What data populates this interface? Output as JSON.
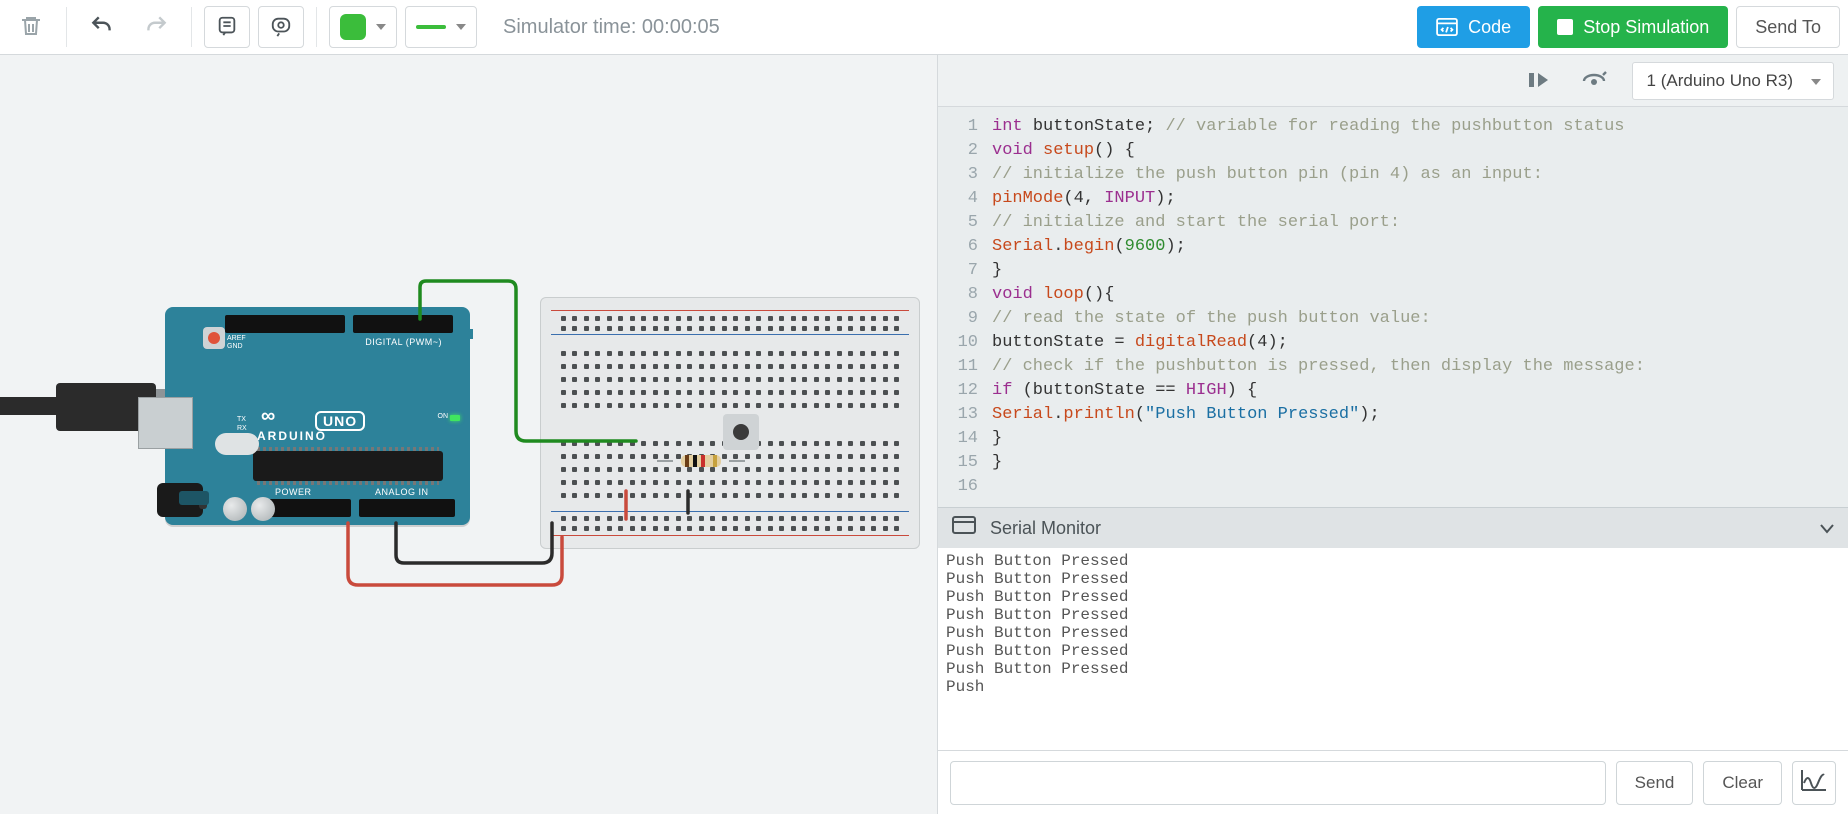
{
  "toolbar": {
    "sim_time_label": "Simulator time: 00:00:05",
    "code_label": "Code",
    "stop_label": "Stop Simulation",
    "sendto_label": "Send To",
    "color_swatch": "#3bbd3b",
    "wire_color": "#3bbd3b"
  },
  "code_header": {
    "board_select": "1 (Arduino Uno R3)"
  },
  "editor": {
    "line_numbers": [
      "1",
      "2",
      "3",
      "4",
      "5",
      "6",
      "7",
      "8",
      "9",
      "10",
      "11",
      "12",
      "13",
      "14",
      "15",
      "16"
    ],
    "lines": [
      [
        {
          "t": "int ",
          "c": "kw"
        },
        {
          "t": "buttonState; ",
          "c": ""
        },
        {
          "t": "// variable for reading the pushbutton status",
          "c": "cm"
        }
      ],
      [
        {
          "t": "void ",
          "c": "kw"
        },
        {
          "t": "setup",
          "c": "fn"
        },
        {
          "t": "() {",
          "c": ""
        }
      ],
      [
        {
          "t": "// initialize the push button pin (pin 4) as an input:",
          "c": "cm"
        }
      ],
      [
        {
          "t": "pinMode",
          "c": "fn"
        },
        {
          "t": "(4, ",
          "c": ""
        },
        {
          "t": "INPUT",
          "c": "kw"
        },
        {
          "t": ");",
          "c": ""
        }
      ],
      [
        {
          "t": "// initialize and start the serial port:",
          "c": "cm"
        }
      ],
      [
        {
          "t": "Serial",
          "c": "fn"
        },
        {
          "t": ".",
          "c": ""
        },
        {
          "t": "begin",
          "c": "fn"
        },
        {
          "t": "(",
          "c": ""
        },
        {
          "t": "9600",
          "c": "num"
        },
        {
          "t": ");",
          "c": ""
        }
      ],
      [
        {
          "t": "}",
          "c": ""
        }
      ],
      [
        {
          "t": "void ",
          "c": "kw"
        },
        {
          "t": "loop",
          "c": "fn"
        },
        {
          "t": "(){",
          "c": ""
        }
      ],
      [
        {
          "t": "// read the state of the push button value:",
          "c": "cm"
        }
      ],
      [
        {
          "t": "buttonState = ",
          "c": ""
        },
        {
          "t": "digitalRead",
          "c": "fn"
        },
        {
          "t": "(4);",
          "c": ""
        }
      ],
      [
        {
          "t": "// check if the pushbutton is pressed, then display the message:",
          "c": "cm"
        }
      ],
      [
        {
          "t": "if ",
          "c": "kw"
        },
        {
          "t": "(buttonState == ",
          "c": ""
        },
        {
          "t": "HIGH",
          "c": "kw"
        },
        {
          "t": ") {",
          "c": ""
        }
      ],
      [
        {
          "t": "Serial",
          "c": "fn"
        },
        {
          "t": ".",
          "c": ""
        },
        {
          "t": "println",
          "c": "fn"
        },
        {
          "t": "(",
          "c": ""
        },
        {
          "t": "\"Push Button Pressed\"",
          "c": "str"
        },
        {
          "t": ");",
          "c": ""
        }
      ],
      [
        {
          "t": "}",
          "c": ""
        }
      ],
      [
        {
          "t": "}",
          "c": ""
        }
      ],
      [
        {
          "t": "",
          "c": ""
        }
      ]
    ]
  },
  "serial": {
    "title": "Serial Monitor",
    "output": [
      "Push Button Pressed",
      "Push Button Pressed",
      "Push Button Pressed",
      "Push Button Pressed",
      "Push Button Pressed",
      "Push Button Pressed",
      "Push Button Pressed",
      "Push"
    ],
    "send_label": "Send",
    "clear_label": "Clear",
    "input_value": ""
  },
  "arduino": {
    "brand": "ARDUINO",
    "model": "UNO",
    "section_digital": "DIGITAL (PWM~)",
    "section_power": "POWER",
    "section_analog": "ANALOG IN",
    "on_label": "ON",
    "tx_label": "TX",
    "rx_label": "RX",
    "aref": "AREF",
    "gnd": "GND"
  }
}
